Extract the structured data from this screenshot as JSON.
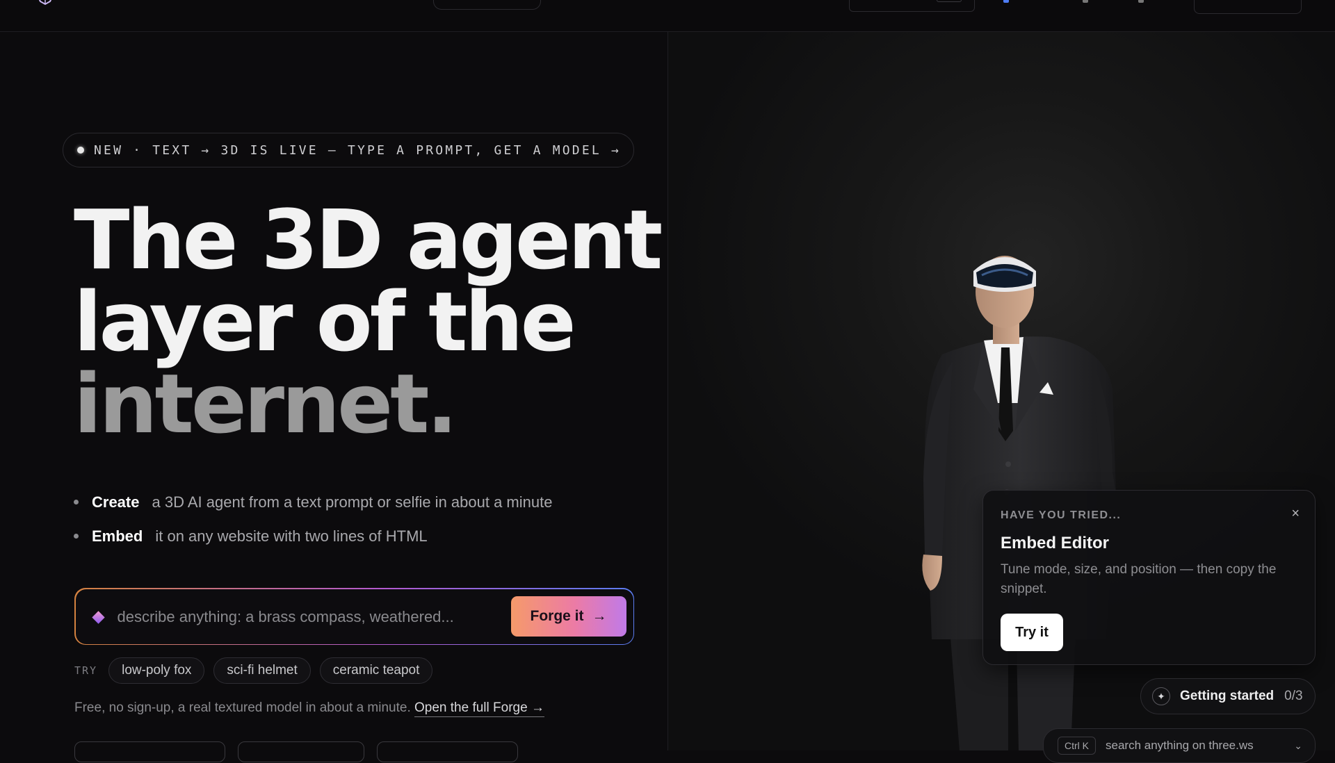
{
  "announcement": {
    "text": "NEW · TEXT → 3D IS LIVE — TYPE A PROMPT, GET A MODEL →"
  },
  "hero": {
    "line1": "The 3D agent",
    "line2": "layer of the",
    "line3": "internet."
  },
  "bullets": [
    {
      "strong": "Create",
      "text": "a 3D AI agent from a text prompt or selfie in about a minute"
    },
    {
      "strong": "Embed",
      "text": "it on any website with two lines of HTML"
    }
  ],
  "prompt": {
    "placeholder": "describe anything: a brass compass, weathered...",
    "button_label": "Forge it",
    "button_arrow": "→"
  },
  "suggestions": {
    "label": "TRY",
    "chips": [
      "low-poly fox",
      "sci-fi helmet",
      "ceramic teapot"
    ]
  },
  "fineprint": {
    "text": "Free, no sign-up, a real textured model in about a minute.",
    "link": "Open the full Forge →"
  },
  "tip_card": {
    "eyebrow": "HAVE YOU TRIED...",
    "close": "×",
    "title": "Embed Editor",
    "body": "Tune mode, size, and position — then copy the snippet.",
    "button": "Try it"
  },
  "getting_started": {
    "icon": "✦",
    "label": "Getting started",
    "count": "0/3"
  },
  "search": {
    "shortcut": "Ctrl K",
    "placeholder": "search anything on three.ws",
    "chevron": "⌄"
  },
  "icons": {
    "logo": "logo-icon",
    "prompt": "diamond-icon",
    "getting_started": "sparkle-icon",
    "close": "close-icon"
  },
  "colors": {
    "background": "#0c0b0d",
    "accent_orange": "#f59a6a",
    "accent_pink": "#ec7ba5",
    "accent_purple": "#c07ae8",
    "accent_blue": "#5b7cf0"
  }
}
